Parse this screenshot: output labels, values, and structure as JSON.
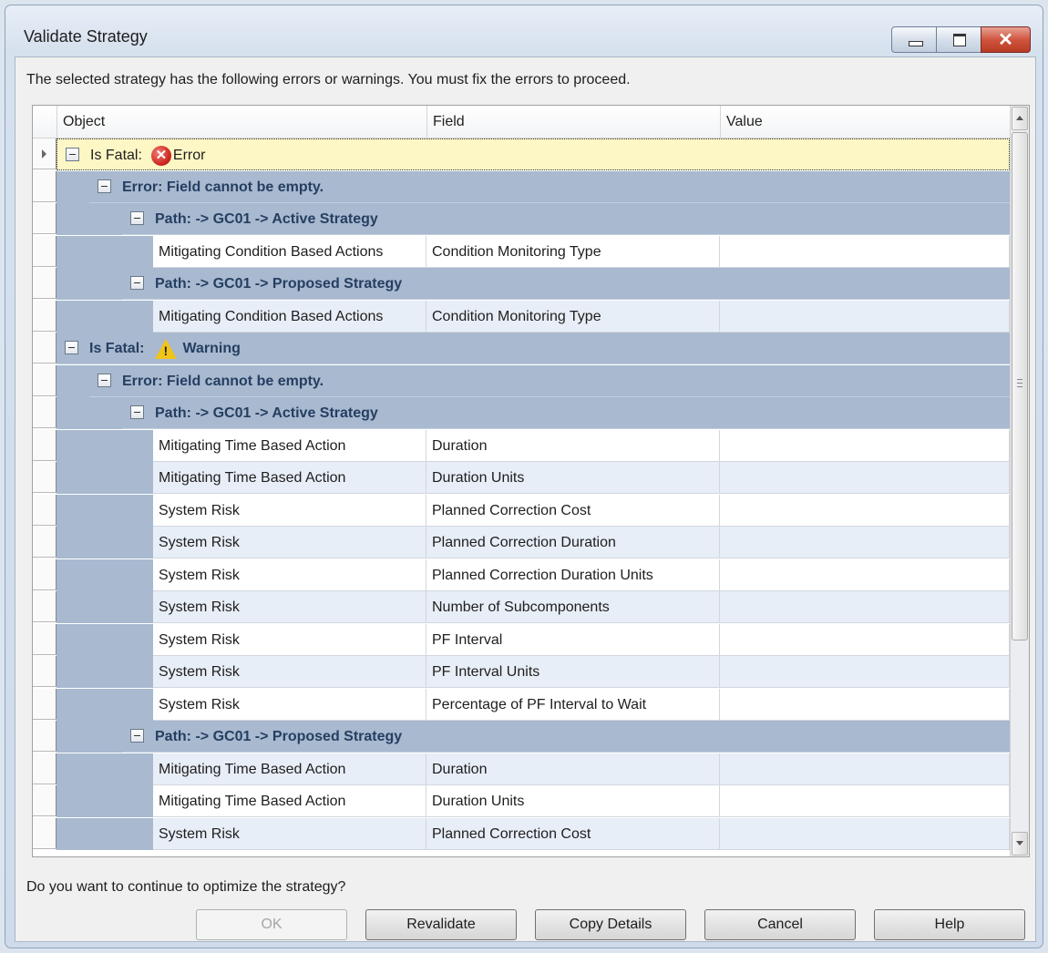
{
  "window": {
    "title": "Validate Strategy",
    "message": "The selected strategy has the following errors or warnings.  You must fix the errors to proceed.",
    "question": "Do you want to continue to optimize the strategy?"
  },
  "grid": {
    "columns": [
      "Object",
      "Field",
      "Value"
    ],
    "rows": [
      {
        "kind": "group",
        "level": 0,
        "label": "Is Fatal:",
        "icon": "error-icon",
        "status": "Error",
        "current": true
      },
      {
        "kind": "group",
        "level": 1,
        "label": "Error: Field cannot be empty."
      },
      {
        "kind": "group",
        "level": 2,
        "label": "Path: -> GC01 -> Active Strategy"
      },
      {
        "kind": "data",
        "object": "Mitigating Condition Based Actions",
        "field": "Condition Monitoring Type",
        "value": ""
      },
      {
        "kind": "group",
        "level": 2,
        "label": "Path: -> GC01 -> Proposed Strategy"
      },
      {
        "kind": "data",
        "object": "Mitigating Condition Based Actions",
        "field": "Condition Monitoring Type",
        "value": ""
      },
      {
        "kind": "group",
        "level": 0,
        "label": "Is Fatal:",
        "icon": "warning-icon",
        "status": "Warning"
      },
      {
        "kind": "group",
        "level": 1,
        "label": "Error: Field cannot be empty."
      },
      {
        "kind": "group",
        "level": 2,
        "label": "Path: -> GC01 -> Active Strategy"
      },
      {
        "kind": "data",
        "object": "Mitigating Time Based Action",
        "field": "Duration",
        "value": ""
      },
      {
        "kind": "data",
        "object": "Mitigating Time Based Action",
        "field": "Duration Units",
        "value": ""
      },
      {
        "kind": "data",
        "object": "System Risk",
        "field": "Planned Correction Cost",
        "value": ""
      },
      {
        "kind": "data",
        "object": "System Risk",
        "field": "Planned Correction Duration",
        "value": ""
      },
      {
        "kind": "data",
        "object": "System Risk",
        "field": "Planned Correction Duration Units",
        "value": ""
      },
      {
        "kind": "data",
        "object": "System Risk",
        "field": "Number of Subcomponents",
        "value": ""
      },
      {
        "kind": "data",
        "object": "System Risk",
        "field": "PF Interval",
        "value": ""
      },
      {
        "kind": "data",
        "object": "System Risk",
        "field": "PF Interval Units",
        "value": ""
      },
      {
        "kind": "data",
        "object": "System Risk",
        "field": "Percentage of PF Interval to Wait",
        "value": ""
      },
      {
        "kind": "group",
        "level": 2,
        "label": "Path: -> GC01 -> Proposed Strategy"
      },
      {
        "kind": "data",
        "object": "Mitigating Time Based Action",
        "field": "Duration",
        "value": ""
      },
      {
        "kind": "data",
        "object": "Mitigating Time Based Action",
        "field": "Duration Units",
        "value": ""
      },
      {
        "kind": "data",
        "object": "System Risk",
        "field": "Planned Correction Cost",
        "value": ""
      }
    ]
  },
  "buttons": {
    "ok": "OK",
    "revalidate": "Revalidate",
    "copy_details": "Copy Details",
    "cancel": "Cancel",
    "help": "Help"
  },
  "colors": {
    "group_band": "#a8b9d0",
    "group_text": "#253f61",
    "current_row": "#fcf7c5",
    "alt_row": "#e8eef7"
  }
}
